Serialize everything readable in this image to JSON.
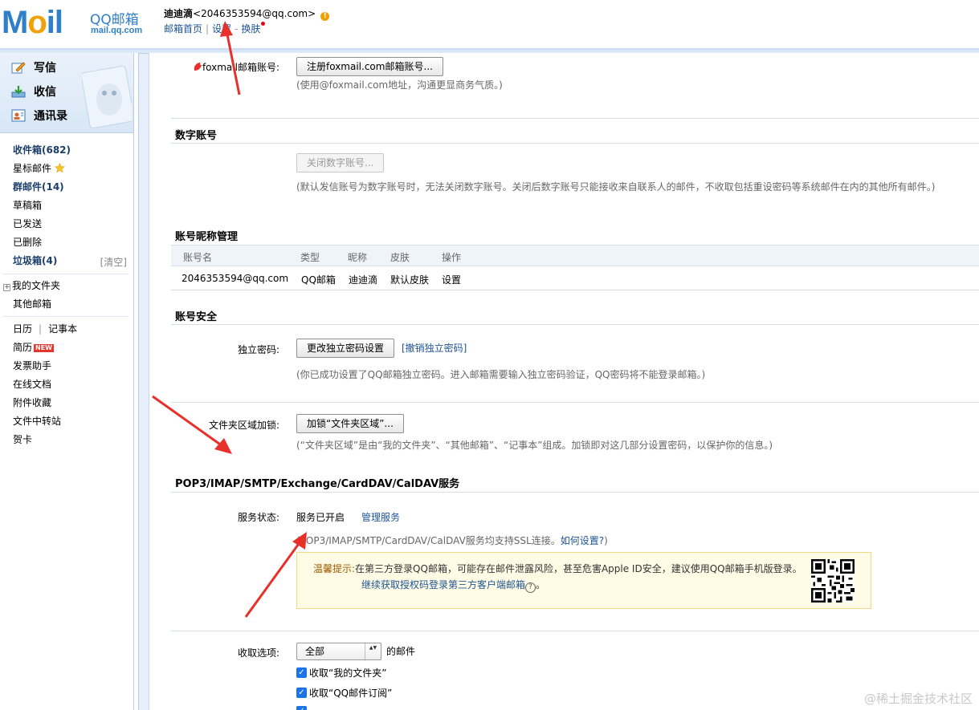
{
  "header": {
    "logo_text_m": "M",
    "logo_text_o": "o",
    "logo_text_il": "il",
    "logo_brand": "QQ邮箱",
    "logo_domain": "mail.qq.com",
    "user_name": "迪迪滴",
    "user_email": "<2046353594@qq.com>",
    "warn_glyph": "!",
    "links": [
      "邮箱首页",
      "设置",
      "换肤"
    ],
    "sep_pipe": "|",
    "sep_dash": "-"
  },
  "sidebar": {
    "quick": [
      {
        "label": "写信",
        "icon": "pencil-icon"
      },
      {
        "label": "收信",
        "icon": "inbox-download-icon"
      },
      {
        "label": "通讯录",
        "icon": "contacts-icon"
      }
    ],
    "folders": {
      "inbox": "收件箱(682)",
      "starred": "星标邮件",
      "group": "群邮件(14)",
      "drafts": "草稿箱",
      "sent": "已发送",
      "deleted": "已删除",
      "spam": "垃圾箱(4)",
      "clear": "[清空]",
      "my_folders": "我的文件夹",
      "other_mail": "其他邮箱",
      "calendar": "日历",
      "notebook": "记事本",
      "cal_sep": "|",
      "resume": "简历",
      "new_badge": "NEW",
      "invoice": "发票助手",
      "docs": "在线文档",
      "attachments": "附件收藏",
      "transfer": "文件中转站",
      "cards": "贺卡"
    }
  },
  "foxmail": {
    "label": "foxmail邮箱账号:",
    "button": "注册foxmail.com邮箱账号...",
    "hint": "(使用@foxmail.com地址，沟通更显商务气质。)"
  },
  "digital": {
    "title": "数字账号",
    "button": "关闭数字账号...",
    "hint": "(默认发信账号为数字账号时，无法关闭数字账号。关闭后数字账号只能接收来自联系人的邮件，不收取包括重设密码等系统邮件在内的其他所有邮件。)"
  },
  "nickname": {
    "title": "账号昵称管理",
    "columns": [
      "账号名",
      "类型",
      "昵称",
      "皮肤",
      "操作"
    ],
    "row": {
      "account": "2046353594@qq.com",
      "type": "QQ邮箱",
      "nick": "迪迪滴",
      "skin": "默认皮肤",
      "action": "设置"
    }
  },
  "security": {
    "title": "账号安全",
    "pwd_label": "独立密码:",
    "pwd_button": "更改独立密码设置",
    "pwd_revoke": "[撤销独立密码]",
    "pwd_hint": "(你已成功设置了QQ邮箱独立密码。进入邮箱需要输入独立密码验证，QQ密码将不能登录邮箱。)",
    "lock_label": "文件夹区域加锁:",
    "lock_button": "加锁“文件夹区域”...",
    "lock_hint": "(“文件夹区域”是由“我的文件夹”、“其他邮箱”、“记事本”组成。加锁即对这几部分设置密码，以保护你的信息。)"
  },
  "pop3": {
    "title": "POP3/IMAP/SMTP/Exchange/CardDAV/CalDAV服务",
    "status_label": "服务状态:",
    "status_value": "服务已开启",
    "manage_link": "管理服务",
    "ssl_hint_prefix": "(POP3/IMAP/SMTP/CardDAV/CalDAV服务均支持SSL连接。",
    "ssl_hint_link": "如何设置?",
    "ssl_hint_suffix": ")",
    "warn_label": "温馨提示:",
    "warn_text": "在第三方登录QQ邮箱，可能存在邮件泄露风险，甚至危害Apple ID安全，建议使用QQ邮箱手机版登录。",
    "warn_link": "继续获取授权码登录第三方客户端邮箱",
    "warn_link_suffix": "。",
    "help_glyph": "?"
  },
  "fetch": {
    "label": "收取选项:",
    "select_value": "全部",
    "select_arrow": "▲▼",
    "suffix": "的邮件",
    "checkbox_glyph": "✓",
    "options": [
      "收取“我的文件夹”",
      "收取“QQ邮件订阅”"
    ]
  },
  "watermark": "@稀土掘金技术社区",
  "colors": {
    "link": "#1e5494",
    "arrow": "#e8302a",
    "brand": "#2f7fc9"
  }
}
